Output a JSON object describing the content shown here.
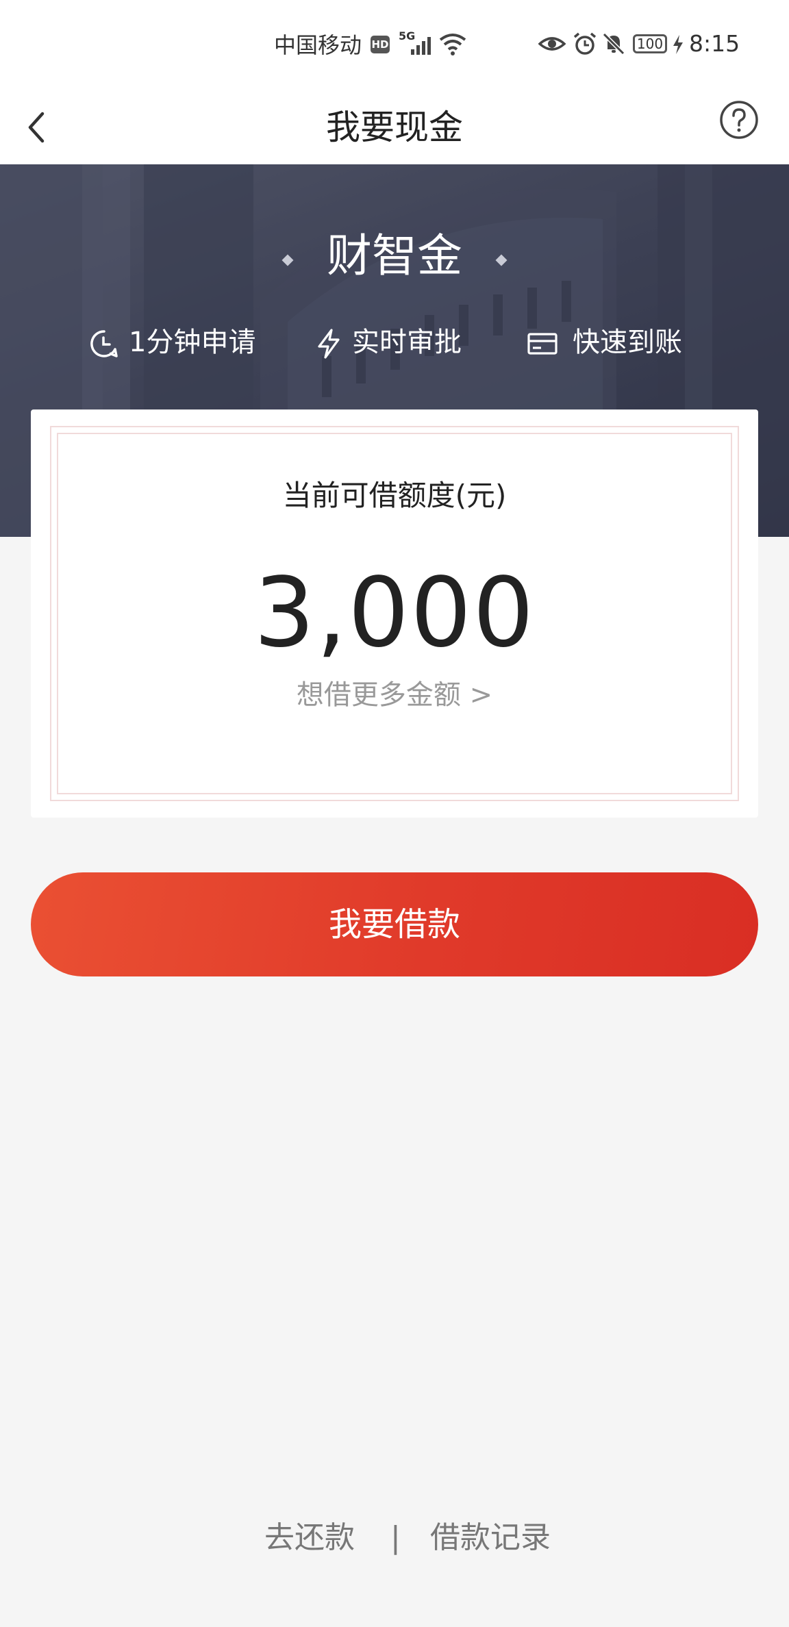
{
  "status_bar": {
    "carrier": "中国移动",
    "hd_badge": "HD",
    "network": "5G",
    "battery": "100",
    "time": "8:15",
    "icons": [
      "signal-icon",
      "wifi-icon",
      "eye-icon",
      "alarm-icon",
      "mute-icon",
      "charging-icon"
    ]
  },
  "nav": {
    "title": "我要现金",
    "back_icon": "chevron-left-icon",
    "help_icon": "help-circle-icon"
  },
  "hero": {
    "brand": "财智金",
    "features": [
      {
        "icon": "clock-icon",
        "label": "1分钟申请"
      },
      {
        "icon": "lightning-icon",
        "label": "实时审批"
      },
      {
        "icon": "card-icon",
        "label": "快速到账"
      }
    ]
  },
  "card": {
    "label": "当前可借额度(元)",
    "amount": "3,000",
    "more_link": "想借更多金额 >"
  },
  "actions": {
    "borrow_label": "我要借款"
  },
  "footer": {
    "repay_label": "去还款",
    "divider": "|",
    "records_label": "借款记录"
  },
  "colors": {
    "primary_red": "#e03a2a",
    "hero_dark": "#43475c",
    "background": "#f5f5f5"
  }
}
